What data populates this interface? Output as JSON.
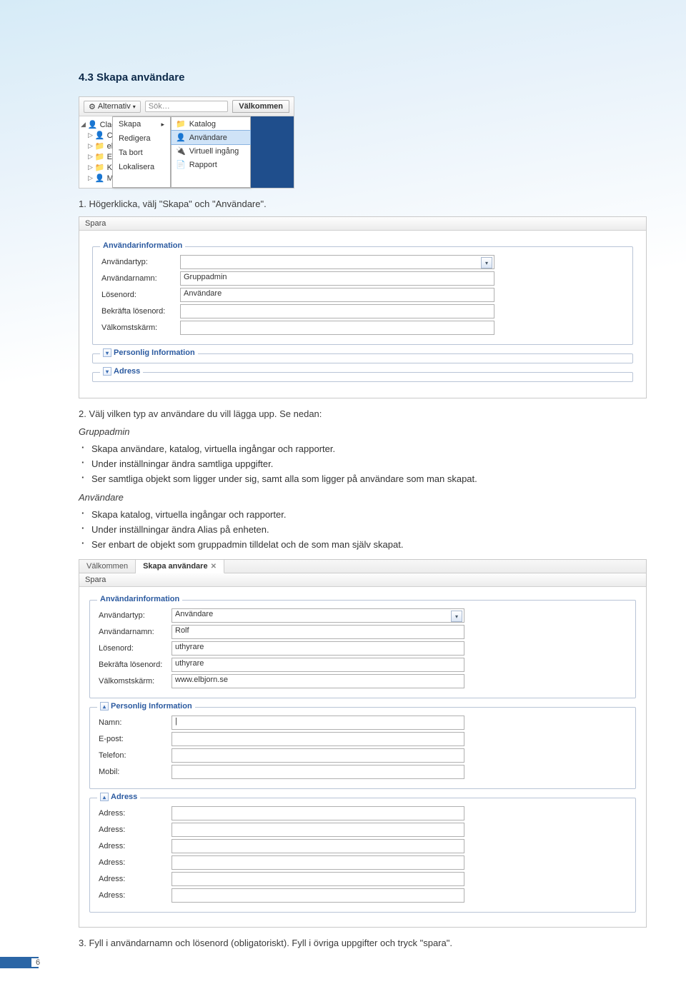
{
  "heading": "4.3 Skapa användare",
  "page_number": "6",
  "ss1": {
    "alternativ": "Alternativ",
    "search_placeholder": "Sök…",
    "welcome": "Välkommen",
    "tree": {
      "root": "Claes",
      "cl": "Cl",
      "el1": "el",
      "el2": "El",
      "ku": "Ku",
      "ma": "M"
    },
    "menu": [
      "Skapa",
      "Redigera",
      "Ta bort",
      "Lokalisera"
    ],
    "submenu": [
      "Katalog",
      "Användare",
      "Virtuell ingång",
      "Rapport"
    ]
  },
  "steps": [
    "1.  Högerklicka, välj \"Skapa\" och \"Användare\".",
    "2.  Välj vilken typ av användare du vill lägga upp. Se nedan:",
    "3.  Fyll i användarnamn och lösenord (obligatoriskt). Fyll i övriga uppgifter och tryck \"spara\"."
  ],
  "ss2": {
    "spara": "Spara",
    "legend_info": "Användarinformation",
    "legend_pers": "Personlig Information",
    "legend_adr": "Adress",
    "labels": {
      "typ": "Användartyp:",
      "namn": "Användarnamn:",
      "losen": "Lösenord:",
      "bekrafta": "Bekräfta lösenord:",
      "valkomst": "Välkomstskärm:"
    },
    "values": {
      "namn": "Gruppadmin",
      "losen": "Användare"
    }
  },
  "gruppadmin": {
    "title": "Gruppadmin",
    "items": [
      "Skapa användare, katalog, virtuella ingångar och rapporter.",
      "Under inställningar ändra samtliga uppgifter.",
      "Ser samtliga objekt som ligger under sig, samt alla som ligger på användare som man skapat."
    ]
  },
  "anvandare": {
    "title": "Användare",
    "items": [
      "Skapa katalog, virtuella ingångar och rapporter.",
      "Under inställningar ändra Alias på enheten.",
      "Ser enbart de objekt som gruppadmin tilldelat och de som man själv skapat."
    ]
  },
  "ss3": {
    "tabs": [
      "Välkommen",
      "Skapa användare"
    ],
    "spara": "Spara",
    "legend_info": "Användarinformation",
    "legend_pers": "Personlig Information",
    "legend_adr": "Adress",
    "labels": {
      "typ": "Användartyp:",
      "namn": "Användarnamn:",
      "losen": "Lösenord:",
      "bekrafta": "Bekräfta lösenord:",
      "valkomst": "Välkomstskärm:"
    },
    "values": {
      "typ": "Användare",
      "namn": "Rolf",
      "losen": "uthyrare",
      "bekrafta": "uthyrare",
      "valkomst": "www.elbjorn.se"
    },
    "plabels": {
      "namn": "Namn:",
      "epost": "E-post:",
      "telefon": "Telefon:",
      "mobil": "Mobil:"
    },
    "pvalues": {
      "namn": "|"
    },
    "alabel": "Adress:"
  }
}
